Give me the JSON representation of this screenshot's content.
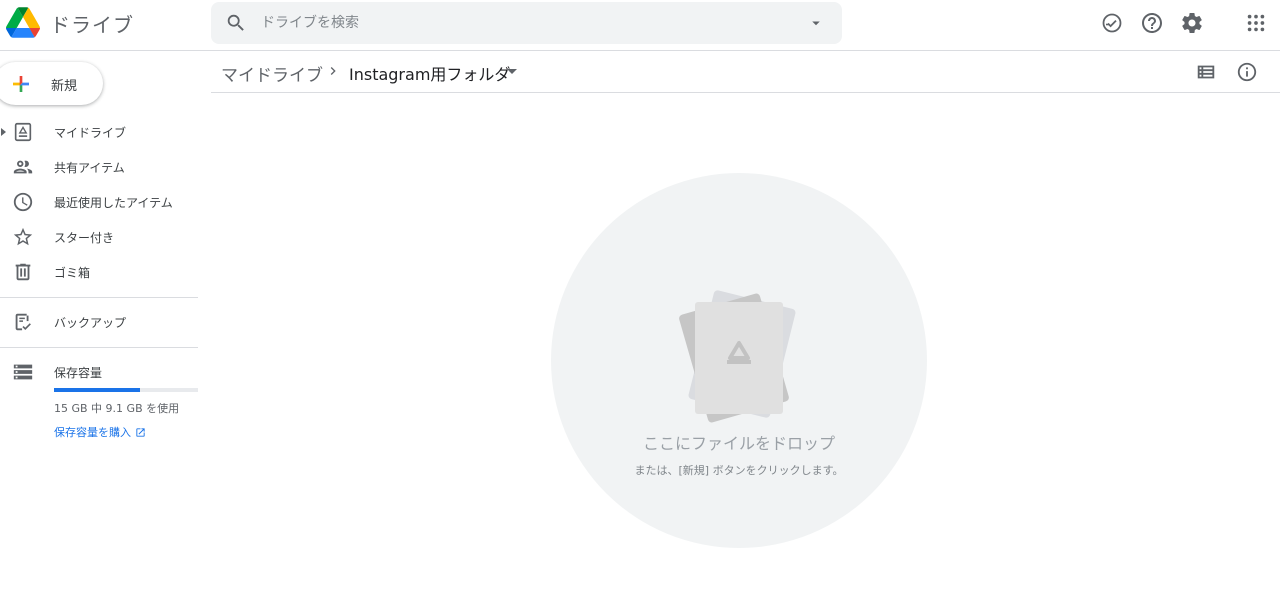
{
  "header": {
    "app_title": "ドライブ",
    "search": {
      "placeholder": "ドライブを検索",
      "value": ""
    },
    "icons": [
      "logo-icon",
      "search-icon",
      "dropdown-arrow-icon",
      "offline-check-icon",
      "help-icon",
      "settings-icon",
      "apps-grid-icon"
    ]
  },
  "sidebar": {
    "new_label": "新規",
    "items": [
      {
        "label": "マイドライブ",
        "icon": "my-drive-icon"
      },
      {
        "label": "共有アイテム",
        "icon": "shared-icon"
      },
      {
        "label": "最近使用したアイテム",
        "icon": "clock-icon"
      },
      {
        "label": "スター付き",
        "icon": "star-icon"
      },
      {
        "label": "ゴミ箱",
        "icon": "trash-icon"
      }
    ],
    "backup_label": "バックアップ",
    "storage": {
      "label": "保存容量",
      "usage_text": "15 GB 中 9.1 GB を使用",
      "used_fraction": 0.6,
      "buy_label": "保存容量を購入"
    }
  },
  "toolbar": {
    "root": "マイドライブ",
    "current_folder": "Instagram用フォルダ"
  },
  "empty_state": {
    "title": "ここにファイルをドロップ",
    "subtitle": "または、[新規] ボタンをクリックします。"
  },
  "colors": {
    "accent": "#1a73e8",
    "text": "#3c4043",
    "muted": "#5f6368",
    "circle_bg": "#f1f3f4",
    "google_blue": "#4285f4",
    "google_red": "#ea4335",
    "google_yellow": "#fbbc04",
    "google_green": "#34a853"
  }
}
